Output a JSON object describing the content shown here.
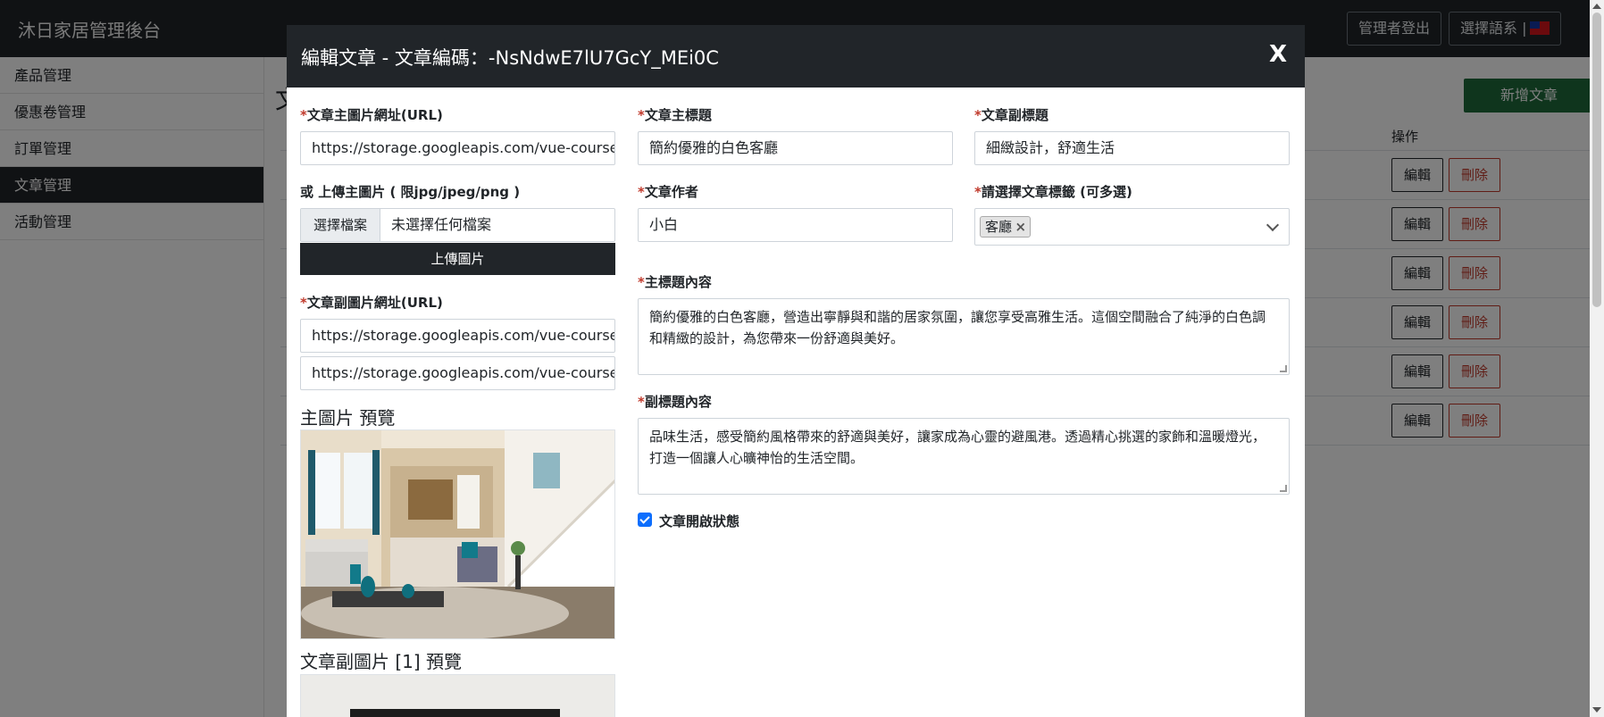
{
  "navbar": {
    "brand": "沐日家居管理後台",
    "logout_label": "管理者登出",
    "language_label": "選擇語系 |"
  },
  "sidebar": {
    "items": [
      {
        "label": "產品管理"
      },
      {
        "label": "優惠卷管理"
      },
      {
        "label": "訂單管理"
      },
      {
        "label": "文章管理",
        "active": true
      },
      {
        "label": "活動管理"
      }
    ]
  },
  "main": {
    "title": "文",
    "add_label": "新增文章",
    "operation_header": "操作",
    "edit_label": "編輯",
    "delete_label": "刪除"
  },
  "modal": {
    "title": "編輯文章 - 文章編碼：-NsNdwE7lU7GcY_MEi0C",
    "close_label": "X",
    "main_image_label": "文章主圖片網址(URL)",
    "main_image_value": "https://storage.googleapis.com/vue-course-",
    "upload_label": "或 上傳主圖片 ( 限jpg/jpeg/png )",
    "choose_file_label": "選擇檔案",
    "no_file_label": "未選擇任何檔案",
    "upload_button_label": "上傳圖片",
    "sub_image_label": "文章副圖片網址(URL)",
    "sub_image_values": [
      "https://storage.googleapis.com/vue-course-",
      "https://storage.googleapis.com/vue-course-"
    ],
    "main_preview_title": "主圖片 預覽",
    "sub_preview_title": "文章副圖片 [1] 預覽",
    "title_label": "文章主標題",
    "title_value": "簡約優雅的白色客廳",
    "subtitle_label": "文章副標題",
    "subtitle_value": "細緻設計，舒適生活",
    "author_label": "文章作者",
    "author_value": "小白",
    "tags_label": "請選擇文章標籤 (可多選)",
    "tags": [
      "客廳"
    ],
    "tag_remove": "×",
    "main_content_label": "主標題內容",
    "main_content_value": "簡約優雅的白色客廳，營造出寧靜與和諧的居家氛圍，讓您享受高雅生活。這個空間融合了純淨的白色調和精緻的設計，為您帶來一份舒適與美好。",
    "sub_content_label": "副標題內容",
    "sub_content_value": "品味生活，感受簡約風格帶來的舒適與美好，讓家成為心靈的避風港。透過精心挑選的家飾和溫暖燈光，打造一個讓人心曠神怡的生活空間。",
    "enabled_label": "文章開啟狀態",
    "enabled": true
  }
}
